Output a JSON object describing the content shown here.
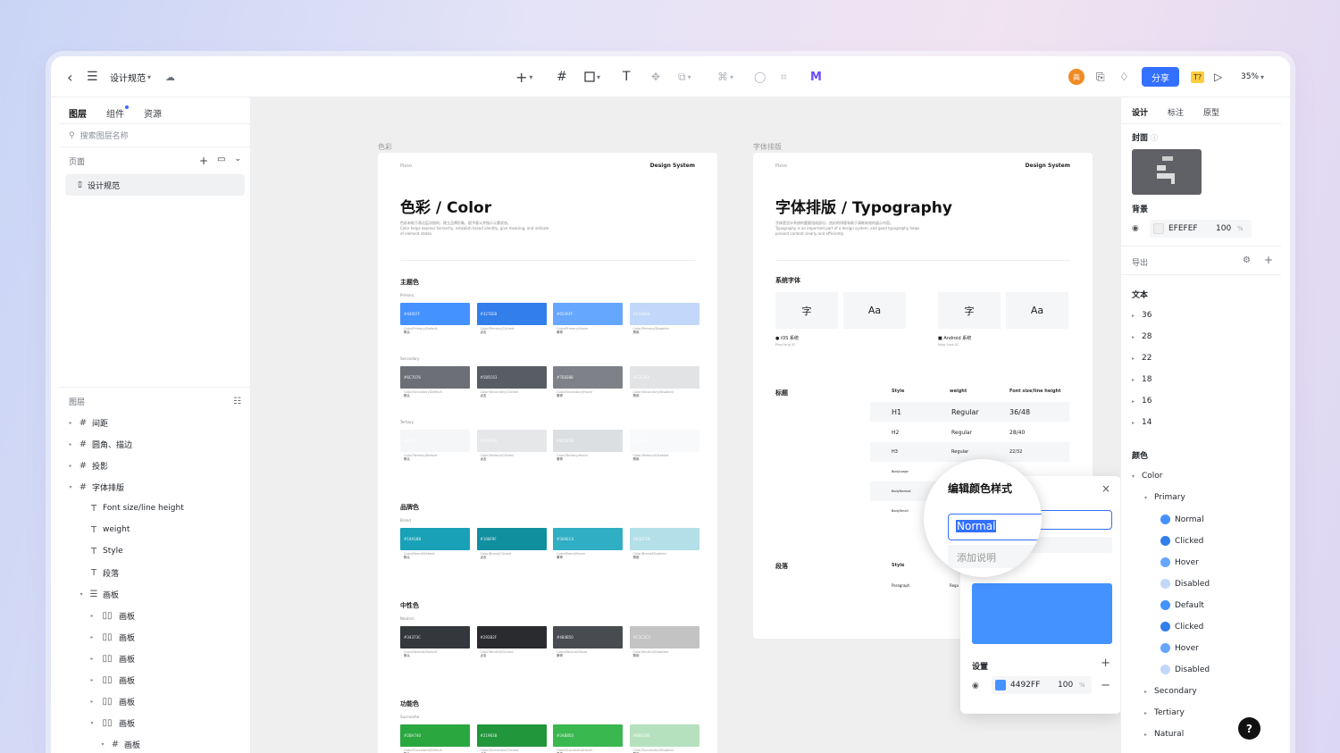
{
  "toolbar": {
    "doc_title": "设计规范",
    "share_label": "分享",
    "zoom": "35%",
    "avatar_text": "高",
    "badge_text": "T?"
  },
  "left": {
    "tabs": [
      "图层",
      "组件",
      "资源"
    ],
    "search_placeholder": "搜索图层名称",
    "pages_label": "页面",
    "page_item": "设计规范",
    "layers_label": "图层",
    "layers": [
      {
        "label": "间距",
        "indent": 0,
        "icon": "frame-icon",
        "twisty": "▸"
      },
      {
        "label": "圆角、描边",
        "indent": 0,
        "icon": "frame-icon",
        "twisty": "▸"
      },
      {
        "label": "投影",
        "indent": 0,
        "icon": "frame-icon",
        "twisty": "▸"
      },
      {
        "label": "字体排版",
        "indent": 0,
        "icon": "frame-icon",
        "twisty": "▾"
      },
      {
        "label": "Font size/line height",
        "indent": 1,
        "icon": "text-icon",
        "twisty": ""
      },
      {
        "label": "weight",
        "indent": 1,
        "icon": "text-icon",
        "twisty": ""
      },
      {
        "label": "Style",
        "indent": 1,
        "icon": "text-icon",
        "twisty": ""
      },
      {
        "label": "段落",
        "indent": 1,
        "icon": "text-icon",
        "twisty": ""
      },
      {
        "label": "画板",
        "indent": 1,
        "icon": "rows-icon",
        "twisty": "▾"
      },
      {
        "label": "画板",
        "indent": 2,
        "icon": "columns-icon",
        "twisty": "▸"
      },
      {
        "label": "画板",
        "indent": 2,
        "icon": "columns-icon",
        "twisty": "▸"
      },
      {
        "label": "画板",
        "indent": 2,
        "icon": "columns-icon",
        "twisty": "▸"
      },
      {
        "label": "画板",
        "indent": 2,
        "icon": "columns-icon",
        "twisty": "▸"
      },
      {
        "label": "画板",
        "indent": 2,
        "icon": "columns-icon",
        "twisty": "▸"
      },
      {
        "label": "画板",
        "indent": 2,
        "icon": "columns-icon",
        "twisty": "▾"
      },
      {
        "label": "画板",
        "indent": 3,
        "icon": "frame-icon",
        "twisty": "▾"
      }
    ]
  },
  "canvas": {
    "color_frame_label": "色彩",
    "type_frame_label": "字体排版",
    "color_frame": {
      "small": "Pixso",
      "brand": "Design System",
      "title": "色彩 / Color",
      "desc1": "色彩有助于表达层次结构，建立品牌形象，赋予意义并指示元素状态。",
      "desc2": "Color helps express hierarchy, establish brand identity, give meaning, and indicate of element states.",
      "sections": [
        {
          "title": "主题色",
          "groups": [
            {
              "sub": "Primary",
              "chips": [
                {
                  "color": "#4492FF",
                  "code": "#4492FF",
                  "cap": "Color/Primary/Default",
                  "state": "默认"
                },
                {
                  "color": "#327EEB",
                  "code": "#327EEB",
                  "cap": "Color/Primary/Clicked",
                  "state": "点击"
                },
                {
                  "color": "#65A6FF",
                  "code": "#65A6FF",
                  "cap": "Color/Primary/Hover",
                  "state": "悬停"
                },
                {
                  "color": "#C1D8FA",
                  "code": "#C1D8FA",
                  "cap": "Color/Primary/Disabled",
                  "state": "禁用"
                }
              ]
            },
            {
              "sub": "Secondary",
              "chips": [
                {
                  "color": "#6C7076",
                  "code": "#6C7076",
                  "cap": "Color/Secondary/Default",
                  "state": "默认"
                },
                {
                  "color": "#585C63",
                  "code": "#585C63",
                  "cap": "Color/Secondary/Clicked",
                  "state": "点击"
                },
                {
                  "color": "#7E8288",
                  "code": "#7E8288",
                  "cap": "Color/Secondary/Hover",
                  "state": "悬停"
                },
                {
                  "color": "#E2E3E4",
                  "code": "#E2E3E4",
                  "cap": "Color/Secondary/Disabled",
                  "state": "禁用"
                }
              ]
            },
            {
              "sub": "Tertiary",
              "chips": [
                {
                  "color": "#F5F6F7",
                  "code": "#F5F6F7",
                  "cap": "Color/Tertiary/Default",
                  "state": "默认"
                },
                {
                  "color": "#E5E7E9",
                  "code": "#E5E7E9",
                  "cap": "Color/Tertiary/Clicked",
                  "state": "点击"
                },
                {
                  "color": "#DCDFE2",
                  "code": "#DCDFE2",
                  "cap": "Color/Tertiary/Hover",
                  "state": "悬停"
                },
                {
                  "color": "#F8F9FA",
                  "code": "#F8F9FA",
                  "cap": "Color/Tertiary/Disabled",
                  "state": "禁用"
                }
              ]
            }
          ]
        },
        {
          "title": "品牌色",
          "groups": [
            {
              "sub": "Brand",
              "chips": [
                {
                  "color": "#19A1B8",
                  "code": "#19A1B8",
                  "cap": "Color/Brand/Default",
                  "state": "默认"
                },
                {
                  "color": "#108F9F",
                  "code": "#108F9F",
                  "cap": "Color/Brand/Clicked",
                  "state": "点击"
                },
                {
                  "color": "#30AEC4",
                  "code": "#30AEC4",
                  "cap": "Color/Brand/Hover",
                  "state": "悬停"
                },
                {
                  "color": "#B3DFE8",
                  "code": "#B3DFE8",
                  "cap": "Color/Brand/Disabled",
                  "state": "禁用"
                }
              ]
            }
          ]
        },
        {
          "title": "中性色",
          "groups": [
            {
              "sub": "Neutral",
              "chips": [
                {
                  "color": "#34373C",
                  "code": "#34373C",
                  "cap": "Color/Neutral/Default",
                  "state": "默认"
                },
                {
                  "color": "#292B2F",
                  "code": "#292B2F",
                  "cap": "Color/Neutral/Clicked",
                  "state": "点击"
                },
                {
                  "color": "#484B50",
                  "code": "#484B50",
                  "cap": "Color/Neutral/Hover",
                  "state": "悬停"
                },
                {
                  "color": "#C3C3C3",
                  "code": "#C3C3C3",
                  "cap": "Color/Neutral/Disabled",
                  "state": "禁用"
                }
              ]
            }
          ]
        },
        {
          "title": "功能色",
          "groups": [
            {
              "sub": "Successful",
              "chips": [
                {
                  "color": "#2BA740",
                  "code": "#2BA740",
                  "cap": "Color/Successful/Default",
                  "state": "默认"
                },
                {
                  "color": "#21963B",
                  "code": "#21963B",
                  "cap": "Color/Successful/Clicked",
                  "state": "点击"
                },
                {
                  "color": "#3AB850",
                  "code": "#3AB850",
                  "cap": "Color/Successful/Hover",
                  "state": "悬停"
                },
                {
                  "color": "#B6E1BE",
                  "code": "#B6E1BE",
                  "cap": "Color/Successful/Disabled",
                  "state": "禁用"
                }
              ]
            }
          ]
        }
      ]
    },
    "type_frame": {
      "small": "Pixso",
      "brand": "Design System",
      "title": "字体排版 / Typography",
      "desc1": "字体是设计系统的重要组成部分，良好的排版有助于清晰有效的展示内容。",
      "desc2": "Typography is an important part of a design system, and good typography helps present content clearly and efficiently.",
      "sys_font_label": "系统字体",
      "boxes": [
        "字",
        "Aa",
        "字",
        "Aa"
      ],
      "ios_label": "iOS 系统",
      "ios_font": "Ping Fang SC",
      "android_label": "Android 系统",
      "android_font": "Noto Sans SC",
      "heading_label": "标题",
      "col_style": "Style",
      "col_weight": "weight",
      "col_size": "Font size/line height",
      "rows": [
        {
          "style": "H1",
          "weight": "Regular",
          "size": "36/48"
        },
        {
          "style": "H2",
          "weight": "Regular",
          "size": "28/40"
        },
        {
          "style": "H3",
          "weight": "Regular",
          "size": "22/32"
        },
        {
          "style": "BodyLarge",
          "weight": "",
          "size": ""
        },
        {
          "style": "BodyNormal",
          "weight": "",
          "size": ""
        },
        {
          "style": "BodySmall",
          "weight": "",
          "size": ""
        }
      ],
      "para_label": "段落",
      "para_style": "Style",
      "para_row": "Paragraph",
      "para_row_weight": "Regu"
    },
    "popup": {
      "title": "编辑颜色样式",
      "name_value": "Normal",
      "desc_placeholder": "添加说明",
      "preview_color": "#4492FF",
      "settings_label": "设置",
      "hex": "4492FF",
      "opacity": "100",
      "percent": "%"
    }
  },
  "right": {
    "tabs": [
      "设计",
      "标注",
      "原型"
    ],
    "cover_label": "封面",
    "bg_label": "背景",
    "bg_hex": "EFEFEF",
    "bg_opacity": "100",
    "bg_percent": "%",
    "export_label": "导出",
    "text_label": "文本",
    "text_sizes": [
      "36",
      "28",
      "22",
      "18",
      "16",
      "14"
    ],
    "color_label": "颜色",
    "color_group": "Color",
    "primary_group": "Primary",
    "primary_styles": [
      {
        "name": "Normal",
        "color": "#4492FF"
      },
      {
        "name": "Clicked",
        "color": "#327EEB"
      },
      {
        "name": "Hover",
        "color": "#65A6FF"
      },
      {
        "name": "Disabled",
        "color": "#C1D8FA"
      },
      {
        "name": "Default",
        "color": "#4492FF"
      },
      {
        "name": "Clicked",
        "color": "#327EEB"
      },
      {
        "name": "Hover",
        "color": "#65A6FF"
      },
      {
        "name": "Disabled",
        "color": "#C1D8FA"
      }
    ],
    "other_groups": [
      "Secondary",
      "Tertiary",
      "Natural"
    ]
  },
  "help_label": "?"
}
